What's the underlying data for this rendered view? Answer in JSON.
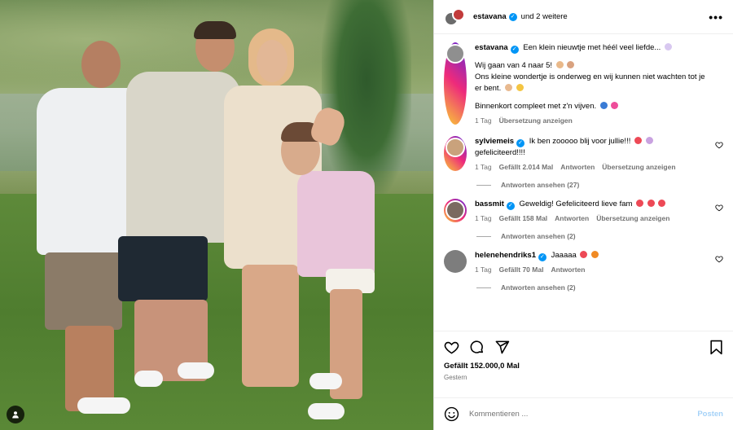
{
  "header": {
    "username": "estavana",
    "others": "und 2 weitere",
    "more_label": "•••"
  },
  "caption": {
    "username": "estavana",
    "line1": "Een klein nieuwtje met héél veel liefde...",
    "line2": "Wij gaan van 4 naar 5!",
    "line3": "Ons kleine wondertje is onderweg en wij kunnen niet wachten tot je er bent.",
    "line4": "Binnenkort compleet met z'n vijven.",
    "time": "1 Tag",
    "translate": "Übersetzung anzeigen"
  },
  "comments": [
    {
      "username": "sylviemeis",
      "text": "Ik ben zooooo blij voor jullie!!!",
      "text2": "gefeliciteerd!!!!",
      "time": "1 Tag",
      "likes": "Gefällt 2.014 Mal",
      "reply": "Antworten",
      "translate": "Übersetzung anzeigen",
      "view_replies": "Antworten ansehen (27)"
    },
    {
      "username": "bassmit",
      "text": "Geweldig! Gefeliciteerd lieve fam",
      "time": "1 Tag",
      "likes": "Gefällt 158 Mal",
      "reply": "Antworten",
      "translate": "Übersetzung anzeigen",
      "view_replies": "Antworten ansehen (2)"
    },
    {
      "username": "helenehendriks1",
      "text": "Jaaaaa",
      "time": "1 Tag",
      "likes": "Gefällt 70 Mal",
      "reply": "Antworten",
      "view_replies": "Antworten ansehen (2)"
    }
  ],
  "post": {
    "likes": "Gefällt 152.000,0 Mal",
    "date": "Gestern"
  },
  "comment_box": {
    "placeholder": "Kommentieren ...",
    "post_label": "Posten"
  },
  "icons": {
    "like": "heart-icon",
    "comment": "comment-icon",
    "share": "share-icon",
    "save": "bookmark-icon",
    "emoji": "emoji-icon",
    "user_tag": "user-tag-icon"
  },
  "colors": {
    "verified": "#0095f6",
    "link_muted": "#a5d2f8",
    "heart": "#ed4956"
  }
}
